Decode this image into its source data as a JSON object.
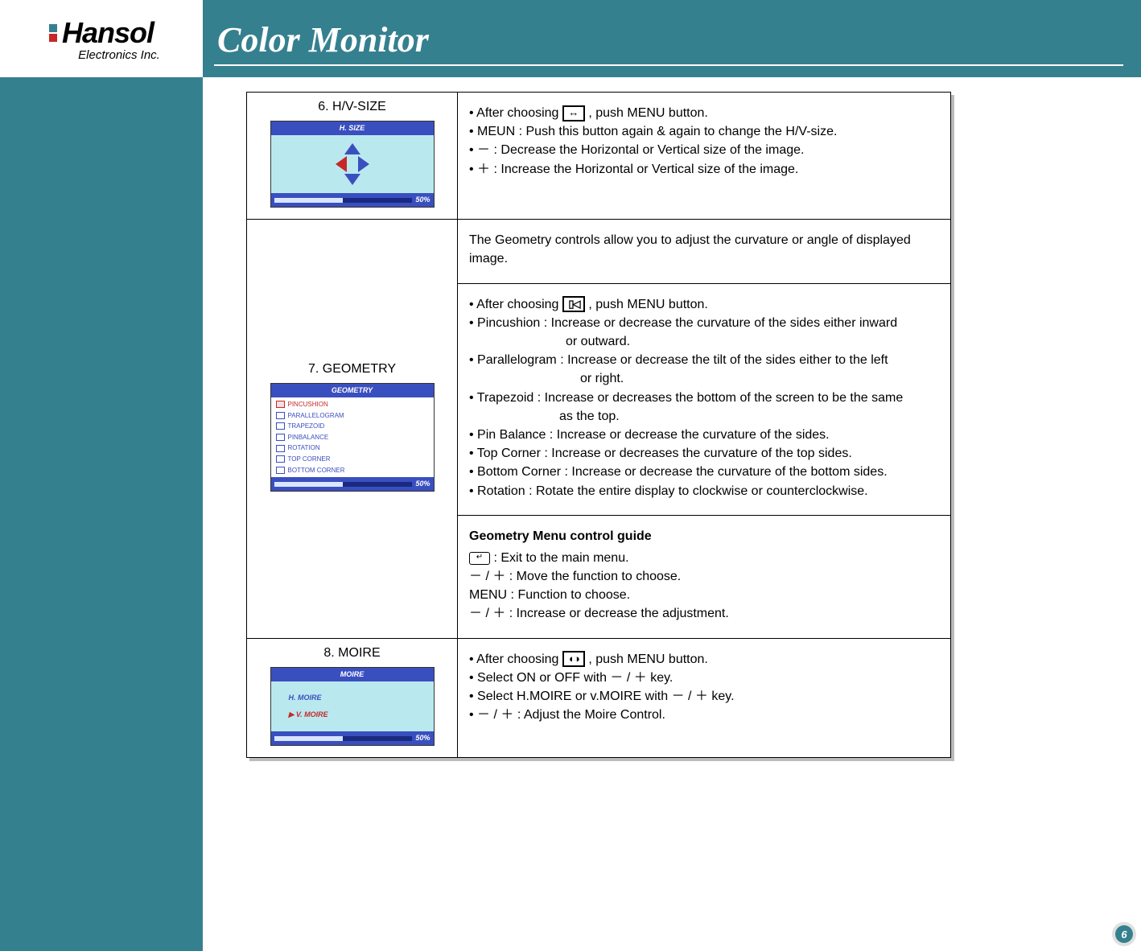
{
  "brand": {
    "name": "Hansol",
    "subtitle": "Electronics Inc."
  },
  "page_title": "Color Monitor",
  "page_number": "6",
  "sections": {
    "hvsize": {
      "label": "6. H/V-SIZE",
      "osd_header": "H. SIZE",
      "osd_percent": "50%",
      "bullets": {
        "b1a": "• After choosing ",
        "b1b": ", push MENU button.",
        "b2": "• MEUN : Push this button again & again to change the H/V-size.",
        "b3": "• － : Decrease the Horizontal or Vertical size of the image.",
        "b4": "• ＋ : Increase the Horizontal or Vertical size of the image."
      }
    },
    "geometry": {
      "label": "7. GEOMETRY",
      "osd_header": "GEOMETRY",
      "osd_items": [
        "PINCUSHION",
        "PARALLELOGRAM",
        "TRAPEZOID",
        "PINBALANCE",
        "ROTATION",
        "TOP CORNER",
        "BOTTOM CORNER"
      ],
      "osd_percent": "50%",
      "intro": "The Geometry controls allow you to adjust the curvature or angle of displayed image.",
      "bullets": {
        "b1a": "• After choosing ",
        "b1b": ", push MENU button.",
        "b2": "• Pincushion : Increase or decrease the curvature of the sides either inward",
        "b2i": "or outward.",
        "b3": "• Parallelogram : Increase or decrease the tilt of the sides either to the left",
        "b3i": "or right.",
        "b4": "• Trapezoid : Increase or decreases the bottom of the screen to be the same",
        "b4i": "as the top.",
        "b5": "• Pin Balance : Increase or decrease the curvature of the sides.",
        "b6": "• Top Corner : Increase or decreases the curvature of the top sides.",
        "b7": "• Bottom Corner : Increase or decrease the curvature of the bottom sides.",
        "b8": "• Rotation : Rotate the entire display to clockwise or counterclockwise."
      },
      "guide": {
        "title": "Geometry Menu control guide",
        "g1": "  : Exit to the main menu.",
        "g2": "－ / ＋    : Move the function to choose.",
        "g3": "MENU : Function to choose.",
        "g4": "－ / ＋    : Increase or decrease the adjustment."
      }
    },
    "moire": {
      "label": "8. MOIRE",
      "osd_header": "MOIRE",
      "osd_h": "H. MOIRE",
      "osd_v": "V. MOIRE",
      "osd_percent": "50%",
      "bullets": {
        "b1a": "• After choosing ",
        "b1b": ", push MENU button.",
        "b2": "• Select ON or OFF with － / ＋  key.",
        "b3": "• Select H.MOIRE or v.MOIRE with － / ＋  key.",
        "b4": "• － / ＋  : Adjust the Moire Control."
      }
    }
  }
}
